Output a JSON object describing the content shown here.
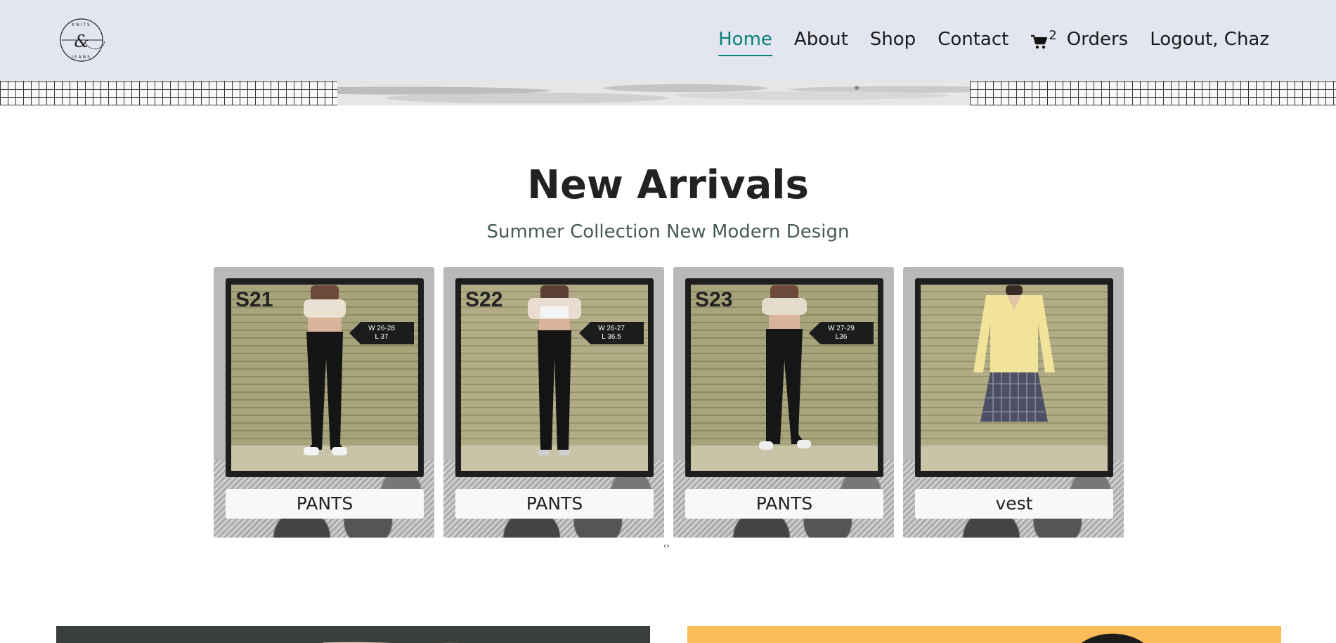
{
  "header": {
    "logo_text_top": "KNITS",
    "logo_text_bottom": "JEANS",
    "logo_glyph": "&",
    "nav": {
      "home": "Home",
      "about": "About",
      "shop": "Shop",
      "contact": "Contact",
      "cart_count": "2",
      "orders": "Orders",
      "logout": "Logout, Chaz"
    },
    "active_color": "#088178"
  },
  "section": {
    "title": "New Arrivals",
    "subtitle": "Summer Collection New Modern Design"
  },
  "products": [
    {
      "code": "S21",
      "tag_w": "W 26-28",
      "tag_l": "L 37",
      "label": "PANTS",
      "icon": "black-flare-pants"
    },
    {
      "code": "S22",
      "tag_w": "W 26-27",
      "tag_l": "L 36.5",
      "label": "PANTS",
      "icon": "black-straight-pants"
    },
    {
      "code": "S23",
      "tag_w": "W 27-29",
      "tag_l": "L36",
      "label": "PANTS",
      "icon": "black-straight-pants"
    },
    {
      "code": "",
      "tag_w": "",
      "tag_l": "",
      "label": "vest",
      "icon": "yellow-sweater-plaid-skirt"
    }
  ],
  "carousel": {
    "prev": "‹",
    "next": "›"
  },
  "colors": {
    "header_bg": "#e3e6f0",
    "card_bg": "#b9b9b9",
    "subtitle": "#465b52",
    "banner_right": "#fbbb58"
  }
}
